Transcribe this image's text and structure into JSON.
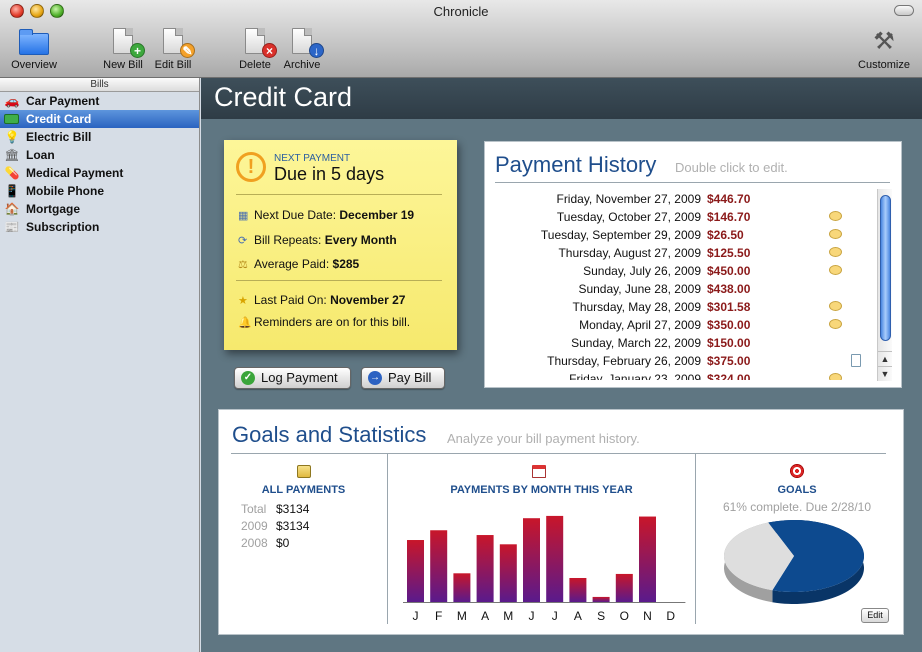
{
  "window": {
    "title": "Chronicle"
  },
  "toolbar": {
    "overview": "Overview",
    "new_bill": "New Bill",
    "edit_bill": "Edit Bill",
    "delete": "Delete",
    "archive": "Archive",
    "customize": "Customize"
  },
  "sidebar": {
    "header": "Bills",
    "items": [
      {
        "label": "Car Payment",
        "icon": "car-icon"
      },
      {
        "label": "Credit Card",
        "icon": "credit-card-icon",
        "selected": true
      },
      {
        "label": "Electric Bill",
        "icon": "lightbulb-icon"
      },
      {
        "label": "Loan",
        "icon": "bank-icon"
      },
      {
        "label": "Medical Payment",
        "icon": "pill-icon"
      },
      {
        "label": "Mobile Phone",
        "icon": "phone-icon"
      },
      {
        "label": "Mortgage",
        "icon": "house-icon"
      },
      {
        "label": "Subscription",
        "icon": "newspaper-icon"
      }
    ]
  },
  "main": {
    "title": "Credit Card",
    "note": {
      "next_payment_label": "NEXT PAYMENT",
      "next_payment_value": "Due in 5 days",
      "due_label": "Next Due Date:",
      "due_value": "December 19",
      "repeats_label": "Bill Repeats:",
      "repeats_value": "Every Month",
      "avg_label": "Average Paid:",
      "avg_value": "$285",
      "last_label": "Last Paid On:",
      "last_value": "November 27",
      "reminders": "Reminders are on for this bill."
    },
    "buttons": {
      "log_payment": "Log Payment",
      "pay_bill": "Pay Bill"
    },
    "history": {
      "title": "Payment History",
      "subtitle": "Double click to edit.",
      "rows": [
        {
          "date": "Friday, November 27, 2009",
          "amount": "$446.70",
          "note": false,
          "doc": false
        },
        {
          "date": "Tuesday, October 27, 2009",
          "amount": "$146.70",
          "note": true,
          "doc": false
        },
        {
          "date": "Tuesday, September 29, 2009",
          "amount": "$26.50",
          "note": true,
          "doc": false
        },
        {
          "date": "Thursday, August 27, 2009",
          "amount": "$125.50",
          "note": true,
          "doc": false
        },
        {
          "date": "Sunday, July 26, 2009",
          "amount": "$450.00",
          "note": true,
          "doc": false
        },
        {
          "date": "Sunday, June 28, 2009",
          "amount": "$438.00",
          "note": false,
          "doc": false
        },
        {
          "date": "Thursday, May 28, 2009",
          "amount": "$301.58",
          "note": true,
          "doc": false
        },
        {
          "date": "Monday, April 27, 2009",
          "amount": "$350.00",
          "note": true,
          "doc": false
        },
        {
          "date": "Sunday, March 22, 2009",
          "amount": "$150.00",
          "note": false,
          "doc": false
        },
        {
          "date": "Thursday, February 26, 2009",
          "amount": "$375.00",
          "note": false,
          "doc": true
        },
        {
          "date": "Friday, January 23, 2009",
          "amount": "$324.00",
          "note": true,
          "doc": false
        }
      ]
    },
    "goals": {
      "title": "Goals and Statistics",
      "subtitle": "Analyze your bill payment history.",
      "all_payments": {
        "heading": "ALL PAYMENTS",
        "rows": [
          {
            "key": "Total",
            "value": "$3134"
          },
          {
            "key": "2009",
            "value": "$3134"
          },
          {
            "key": "2008",
            "value": "$0"
          }
        ]
      },
      "by_month_heading": "PAYMENTS BY MONTH THIS YEAR",
      "goals_heading": "GOALS",
      "goals_status": "61% complete. Due 2/28/10",
      "edit_label": "Edit"
    }
  },
  "chart_data": [
    {
      "type": "bar",
      "title": "PAYMENTS BY MONTH THIS YEAR",
      "categories": [
        "J",
        "F",
        "M",
        "A",
        "M",
        "J",
        "J",
        "A",
        "S",
        "O",
        "N",
        "D"
      ],
      "values": [
        324,
        375,
        150,
        350,
        301.58,
        438,
        450,
        125.5,
        26.5,
        146.7,
        446.7,
        0
      ],
      "ylim": [
        0,
        460
      ],
      "grid": false,
      "colors": {
        "top": "#c8162a",
        "bottom": "#5a1a8c"
      }
    },
    {
      "type": "pie",
      "title": "GOALS",
      "slices": [
        {
          "name": "complete",
          "value": 61,
          "color": "#0d4a8f"
        },
        {
          "name": "remaining",
          "value": 39,
          "color": "#dedede"
        }
      ]
    }
  ]
}
